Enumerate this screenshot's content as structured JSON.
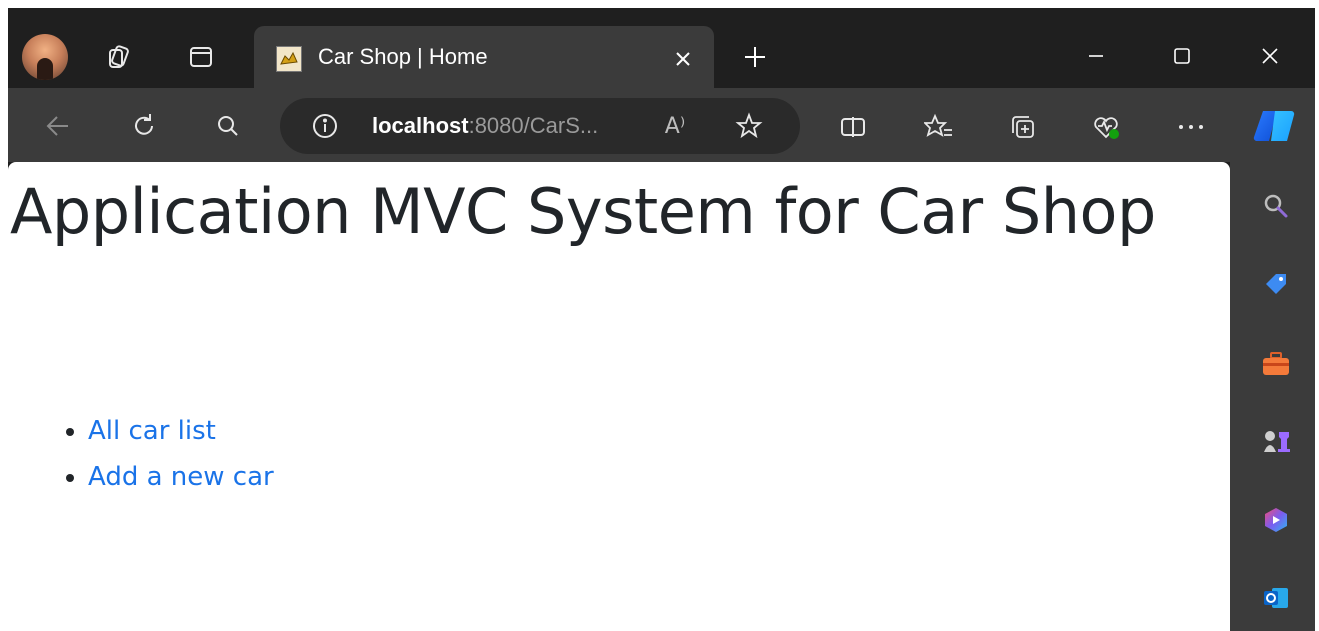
{
  "browser": {
    "tab": {
      "title": "Car Shop | Home"
    },
    "address": {
      "host": "localhost",
      "rest": ":8080/CarS..."
    },
    "read_aloud_label": "A⁾"
  },
  "page": {
    "heading": "Application MVC System for Car Shop",
    "links": [
      {
        "label": "All car list"
      },
      {
        "label": "Add a new car"
      }
    ]
  },
  "colors": {
    "link": "#1a73e8",
    "text": "#212529",
    "chrome_dark": "#1f1f1f",
    "chrome_mid": "#3b3b3b"
  }
}
